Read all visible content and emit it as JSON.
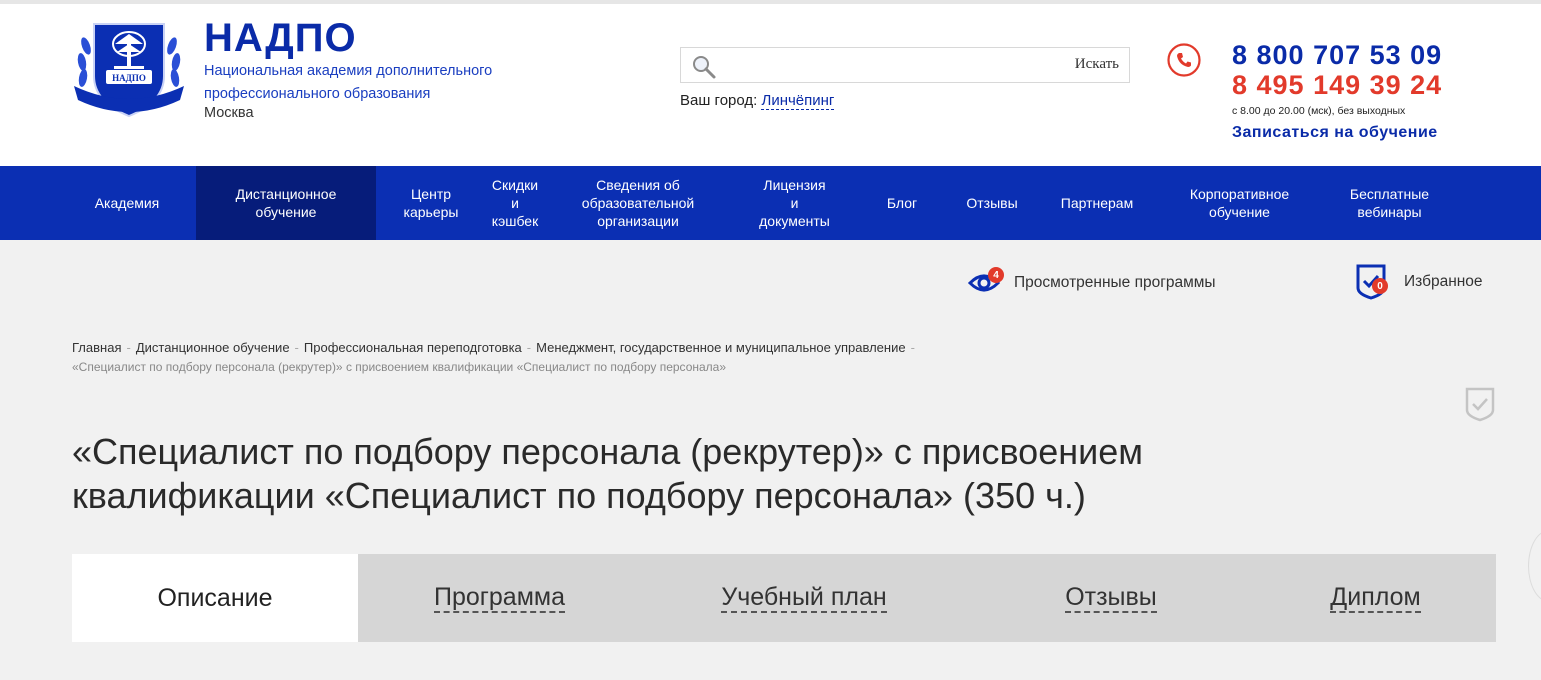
{
  "header": {
    "brand_name": "НАДПО",
    "brand_subtitle_line1": "Национальная академия дополнительного",
    "brand_subtitle_line2": "профессионального образования",
    "brand_city": "Москва",
    "logo_text": "НАДПО",
    "search": {
      "placeholder": "",
      "button_label": "Искать"
    },
    "city_prefix": "Ваш город:",
    "city_name": "Линчёпинг",
    "phone_primary": "8 800 707 53 09",
    "phone_secondary": "8 495 149 39 24",
    "hours": "с 8.00 до 20.00 (мск), без выходных",
    "enroll_label": "Записаться на обучение"
  },
  "nav": {
    "items": [
      {
        "label": "Академия",
        "active": false
      },
      {
        "label": "Дистанционное\nобучение",
        "active": true
      },
      {
        "label": "Центр\nкарьеры",
        "active": false
      },
      {
        "label": "Скидки\nи\nкэшбек",
        "active": false
      },
      {
        "label": "Сведения об\nобразовательной\nорганизации",
        "active": false
      },
      {
        "label": "Лицензия\nи\nдокументы",
        "active": false
      },
      {
        "label": "Блог",
        "active": false
      },
      {
        "label": "Отзывы",
        "active": false
      },
      {
        "label": "Партнерам",
        "active": false
      },
      {
        "label": "Корпоративное\nобучение",
        "active": false
      },
      {
        "label": "Бесплатные\nвебинары",
        "active": false
      }
    ]
  },
  "utility": {
    "viewed_label": "Просмотренные программы",
    "viewed_count": "4",
    "favorites_label": "Избранное",
    "favorites_count": "0"
  },
  "breadcrumbs": {
    "items": [
      "Главная",
      "Дистанционное обучение",
      "Профессиональная переподготовка",
      "Менеджмент, государственное и муниципальное управление"
    ],
    "separator": "-",
    "current": "«Специалист по подбору персонала (рекрутер)» с присвоением квалификации «Специалист по подбору персонала»"
  },
  "page": {
    "title": "«Специалист по подбору персонала (рекрутер)» с присвоением квалификации «Специалист по подбору персонала» (350 ч.)"
  },
  "tabs": [
    {
      "label": "Описание",
      "active": true
    },
    {
      "label": "Программа",
      "active": false
    },
    {
      "label": "Учебный план",
      "active": false
    },
    {
      "label": "Отзывы",
      "active": false
    },
    {
      "label": "Диплом",
      "active": false
    }
  ],
  "colors": {
    "brand_blue": "#0b2fb3",
    "nav_active": "#061c7a",
    "accent_red": "#e23a2b",
    "page_bg": "#f1f1f1"
  }
}
